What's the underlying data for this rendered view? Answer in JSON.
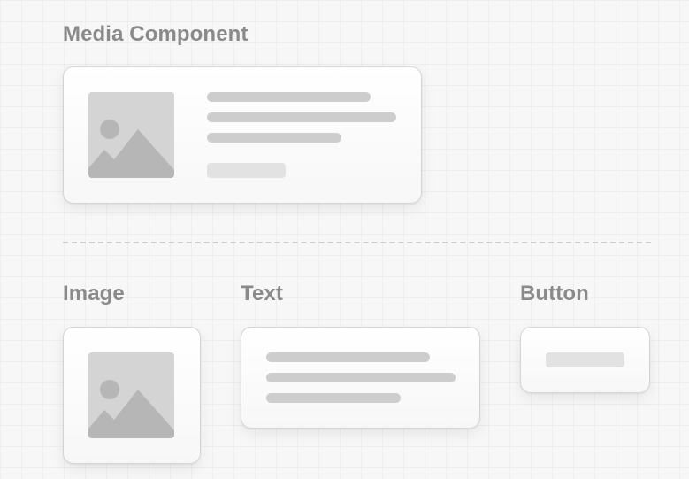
{
  "headings": {
    "media_component": "Media Component",
    "image": "Image",
    "text": "Text",
    "button": "Button"
  },
  "icons": {
    "image_placeholder": "image-placeholder-icon"
  },
  "colors": {
    "background": "#f7f7f7",
    "heading": "#8a8a8a",
    "card_border": "#d5d5d5",
    "placeholder_fill": "#d4d4d4",
    "placeholder_shape": "#b6b6b6",
    "text_bar": "#cdcdcd",
    "button_pill": "#e2e2e2",
    "divider": "#cfcfcf"
  }
}
